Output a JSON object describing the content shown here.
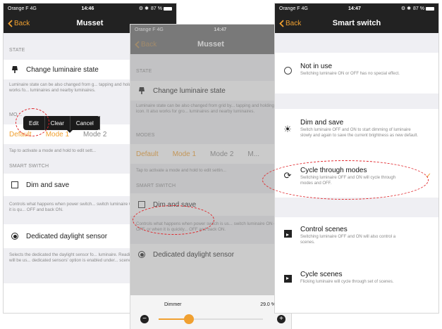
{
  "colors": {
    "accent": "#f0a030",
    "annotation": "#e0262b",
    "navbar": "#222222",
    "section_bg": "#efeff3"
  },
  "screen1": {
    "status": {
      "carrier": "Orange F  4G",
      "time": "14:46",
      "battery": "87 %"
    },
    "nav": {
      "back": "Back",
      "title": "Musset"
    },
    "state_header": "STATE",
    "change_state": "Change luminaire state",
    "state_desc": "Luminaire state can be also changed from g... tapping and holding its icon. It also works fo... luminaires and nearby luminaires.",
    "modes_header": "MO...",
    "popup": {
      "edit": "Edit",
      "clear": "Clear",
      "cancel": "Cancel"
    },
    "modes": [
      "Default",
      "Mode 1",
      "Mode 2"
    ],
    "modes_desc": "Tap to activate a mode and hold to edit sett...",
    "smart_header": "SMART SWITCH",
    "dim_save": "Dim and save",
    "smart_desc": "Controls what happens when power switch... switch luminaire ON or OFF, or when it is qu... OFF and back ON.",
    "daylight": "Dedicated daylight sensor",
    "daylight_desc": "Selects the dedicated the daylight sensor fo... luminaire. Readings of this sensor will be us... dedicated sensors' option is enabled under... scene settings."
  },
  "screen2": {
    "status": {
      "carrier": "Orange F  4G",
      "time": "14:47"
    },
    "nav": {
      "back": "Back",
      "title": "Musset"
    },
    "state_header": "STATE",
    "change_state": "Change luminaire state",
    "state_desc": "Luminaire state can be also changed from grid by... tapping and holding its icon. It also works for gro... luminaires and nearby luminaires.",
    "modes_header": "MODES",
    "modes": [
      "Default",
      "Mode 1",
      "Mode 2",
      "M..."
    ],
    "modes_desc": "Tap to activate a mode and hold to edit settin...",
    "smart_header": "SMART SWITCH",
    "dim_save": "Dim and save",
    "smart_desc": "Controls what happens when power switch is us... switch luminaire ON or OFF, or when it is quickly... OFF and back ON.",
    "daylight": "Dedicated daylight sensor",
    "dimmer": {
      "label": "Dimmer",
      "value": "29.0 %",
      "level": 0.29
    }
  },
  "screen3": {
    "status": {
      "carrier": "Orange F  4G",
      "time": "14:47",
      "battery": "87 %"
    },
    "nav": {
      "back": "Back",
      "title": "Smart switch"
    },
    "options": [
      {
        "title": "Not in use",
        "desc": "Switching luminaire ON or OFF has no special effect."
      },
      {
        "title": "Dim and save",
        "desc": "Switch luminaire OFF and ON to start dimming of luminaire slowly and again to save the current brightness as new default."
      },
      {
        "title": "Cycle through modes",
        "desc": "Switching luminaire OFF and ON will cycle through modes and OFF."
      },
      {
        "title": "Control scenes",
        "desc": "Switching luminaire OFF and ON will also control a scenes."
      },
      {
        "title": "Cycle scenes",
        "desc": "Flicking luminaire will cycle through set of scenes."
      }
    ]
  }
}
